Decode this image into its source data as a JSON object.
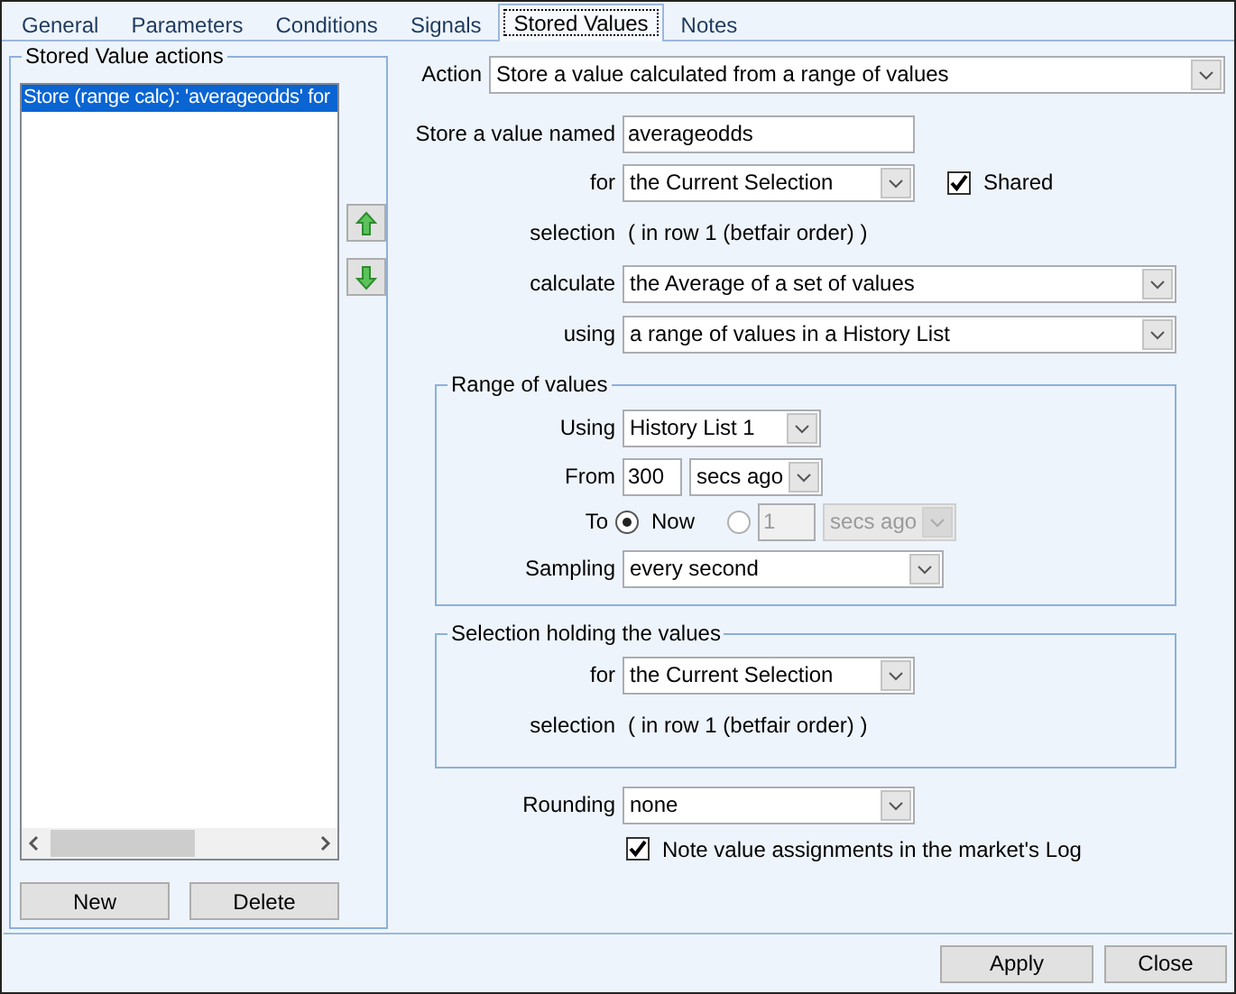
{
  "tabs": [
    {
      "label": "General",
      "selected": false
    },
    {
      "label": "Parameters",
      "selected": false
    },
    {
      "label": "Conditions",
      "selected": false
    },
    {
      "label": "Signals",
      "selected": false
    },
    {
      "label": "Stored Values",
      "selected": true
    },
    {
      "label": "Notes",
      "selected": false
    }
  ],
  "actions_group": {
    "title": "Stored Value actions",
    "items": [
      {
        "label": "Store (range calc): 'averageodds' for",
        "selected": true
      }
    ],
    "buttons": [
      "New",
      "Delete"
    ]
  },
  "form": {
    "action": {
      "label": "Action",
      "value": "Store a value calculated from a range of values"
    },
    "name": {
      "label": "Store a value named",
      "value": "averageodds"
    },
    "for": {
      "label": "for",
      "value": "the Current Selection"
    },
    "shared": {
      "label": "Shared",
      "checked": true
    },
    "selection": {
      "label": "selection",
      "value": "( in row 1 (betfair order) )"
    },
    "calculate": {
      "label": "calculate",
      "value": "the Average of a set of values"
    },
    "using": {
      "label": "using",
      "value": "a range of values in a History List"
    },
    "range_group": {
      "title": "Range of values",
      "using": {
        "label": "Using",
        "value": "History List 1"
      },
      "from": {
        "label": "From",
        "value": "300",
        "unit": "secs ago"
      },
      "to": {
        "label": "To",
        "options": [
          {
            "kind": "now",
            "label": "Now",
            "selected": true
          },
          {
            "kind": "ago",
            "value": "1",
            "unit": "secs ago",
            "selected": false,
            "disabled": true
          }
        ]
      },
      "sampling": {
        "label": "Sampling",
        "value": "every second"
      }
    },
    "selection_group": {
      "title": "Selection holding the values",
      "for": {
        "label": "for",
        "value": "the Current Selection"
      },
      "selection": {
        "label": "selection",
        "value": "( in row 1 (betfair order) )"
      }
    },
    "rounding": {
      "label": "Rounding",
      "value": "none"
    },
    "note_log": {
      "label": "Note value assignments in the market's Log",
      "checked": true
    }
  },
  "footer": {
    "buttons": [
      "Apply",
      "Close"
    ]
  }
}
